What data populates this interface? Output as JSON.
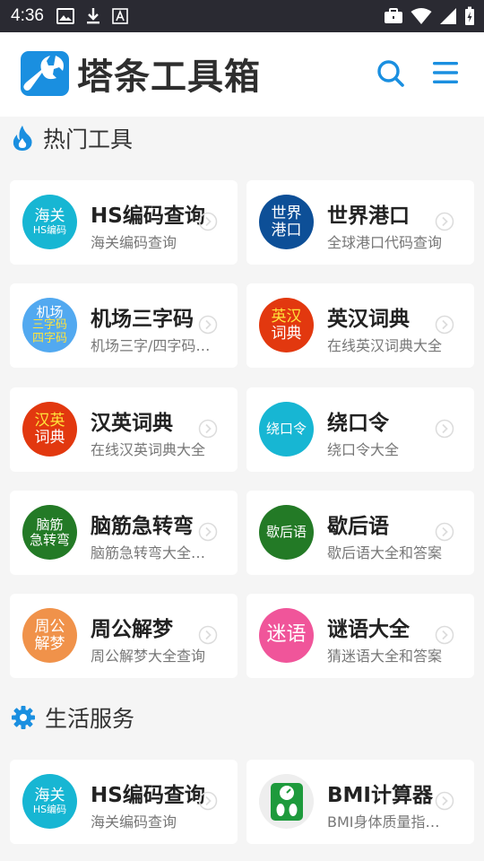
{
  "status_bar": {
    "time": "4:36",
    "left_icons": [
      "image-icon",
      "download-icon",
      "font-a-icon"
    ],
    "right_icons": [
      "briefcase-icon",
      "wifi-icon",
      "signal-icon",
      "battery-charging-icon"
    ]
  },
  "header": {
    "logo_text": "塔条工具箱",
    "brand_color": "#1a8fe0"
  },
  "sections": [
    {
      "title": "热门工具",
      "icon": "flame-icon",
      "cards": [
        {
          "badge_lines": [
            "海关",
            "HS编码"
          ],
          "badge_color": "#17b6d3",
          "title": "HS编码查询",
          "desc": "海关编码查询"
        },
        {
          "badge_lines": [
            "世界",
            "港口"
          ],
          "badge_color": "#0d4f97",
          "title": "世界港口",
          "desc": "全球港口代码查询"
        },
        {
          "badge_lines": [
            "机场",
            "三字码",
            "四字码"
          ],
          "badge_color": "#52a9f0",
          "title": "机场三字码",
          "desc": "机场三字/四字码查询"
        },
        {
          "badge_lines": [
            "英汉",
            "词典"
          ],
          "badge_color": "#e2380f",
          "badge_text_color": "#ffe33b",
          "title": "英汉词典",
          "desc": "在线英汉词典大全"
        },
        {
          "badge_lines": [
            "汉英",
            "词典"
          ],
          "badge_color": "#e2380f",
          "badge_text_color": "#ffe33b",
          "title": "汉英词典",
          "desc": "在线汉英词典大全"
        },
        {
          "badge_lines": [
            "绕口令"
          ],
          "badge_color": "#17b6d3",
          "title": "绕口令",
          "desc": "绕口令大全"
        },
        {
          "badge_lines": [
            "脑筋",
            "急转弯"
          ],
          "badge_color": "#237a26",
          "title": "脑筋急转弯",
          "desc": "脑筋急转弯大全查询"
        },
        {
          "badge_lines": [
            "歇后语"
          ],
          "badge_color": "#237a26",
          "title": "歇后语",
          "desc": "歇后语大全和答案"
        },
        {
          "badge_lines": [
            "周公",
            "解梦"
          ],
          "badge_color": "#f0924a",
          "title": "周公解梦",
          "desc": "周公解梦大全查询"
        },
        {
          "badge_lines": [
            "迷语"
          ],
          "badge_color": "#f0559a",
          "title": "谜语大全",
          "desc": "猜迷语大全和答案"
        }
      ]
    },
    {
      "title": "生活服务",
      "icon": "gear-icon",
      "cards": [
        {
          "badge_lines": [
            "海关",
            "HS编码"
          ],
          "badge_color": "#17b6d3",
          "title": "HS编码查询",
          "desc": "海关编码查询"
        },
        {
          "badge_icon": "scale-icon",
          "badge_color": "#eeeeee",
          "title": "BMI计算器",
          "desc": "BMI身体质量指数计算"
        }
      ]
    }
  ]
}
